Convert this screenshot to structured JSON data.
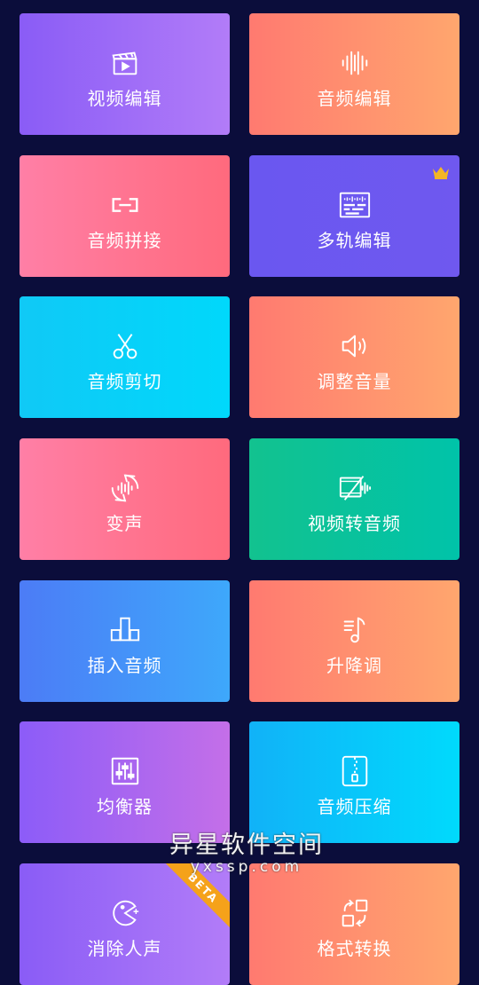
{
  "tiles": [
    {
      "label": "视频编辑",
      "icon": "clapperboard-icon"
    },
    {
      "label": "音频编辑",
      "icon": "waveform-icon"
    },
    {
      "label": "音频拼接",
      "icon": "link-icon"
    },
    {
      "label": "多轨编辑",
      "icon": "multitrack-icon",
      "badge": "crown-icon"
    },
    {
      "label": "音频剪切",
      "icon": "scissors-icon"
    },
    {
      "label": "调整音量",
      "icon": "speaker-icon"
    },
    {
      "label": "变声",
      "icon": "voice-change-icon"
    },
    {
      "label": "视频转音频",
      "icon": "video-to-audio-icon"
    },
    {
      "label": "插入音频",
      "icon": "insert-blocks-icon"
    },
    {
      "label": "升降调",
      "icon": "pitch-note-icon"
    },
    {
      "label": "均衡器",
      "icon": "equalizer-icon"
    },
    {
      "label": "音频压缩",
      "icon": "zip-file-icon"
    },
    {
      "label": "消除人声",
      "icon": "remove-voice-icon",
      "badge_text": "BETA"
    },
    {
      "label": "格式转换",
      "icon": "format-convert-icon"
    }
  ],
  "watermark": {
    "title": "异星软件空间",
    "url": "yxssp.com"
  },
  "colors": {
    "background": "#0b0d3b",
    "crown": "#f5b623",
    "beta": "#f5a21a"
  }
}
